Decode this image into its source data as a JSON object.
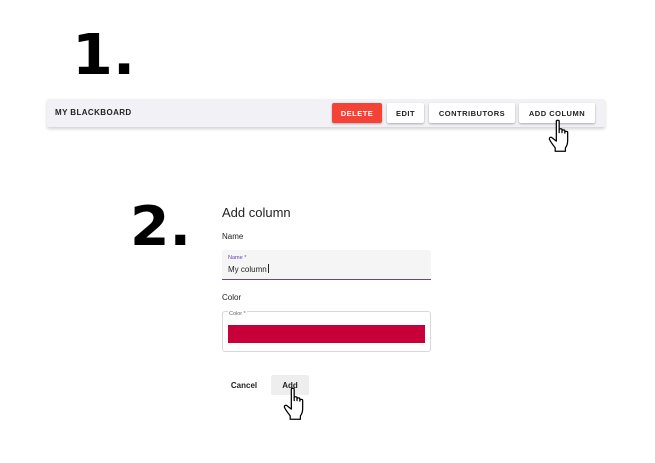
{
  "steps": {
    "first": "1.",
    "second": "2."
  },
  "toolbar": {
    "title": "MY BLACKBOARD",
    "delete_label": "DELETE",
    "edit_label": "EDIT",
    "contributors_label": "CONTRIBUTORS",
    "add_column_label": "ADD COLUMN"
  },
  "dialog": {
    "title": "Add column",
    "name_section": "Name",
    "name_float_label": "Name *",
    "name_value": "My column",
    "color_section": "Color",
    "color_float_label": "Color *",
    "color_value": "#c8003a",
    "cancel_label": "Cancel",
    "add_label": "Add"
  },
  "colors": {
    "delete": "#f44336",
    "focus": "#6a3fb5",
    "swatch": "#c8003a"
  },
  "icons": {
    "cursor": "hand-pointer-icon"
  }
}
